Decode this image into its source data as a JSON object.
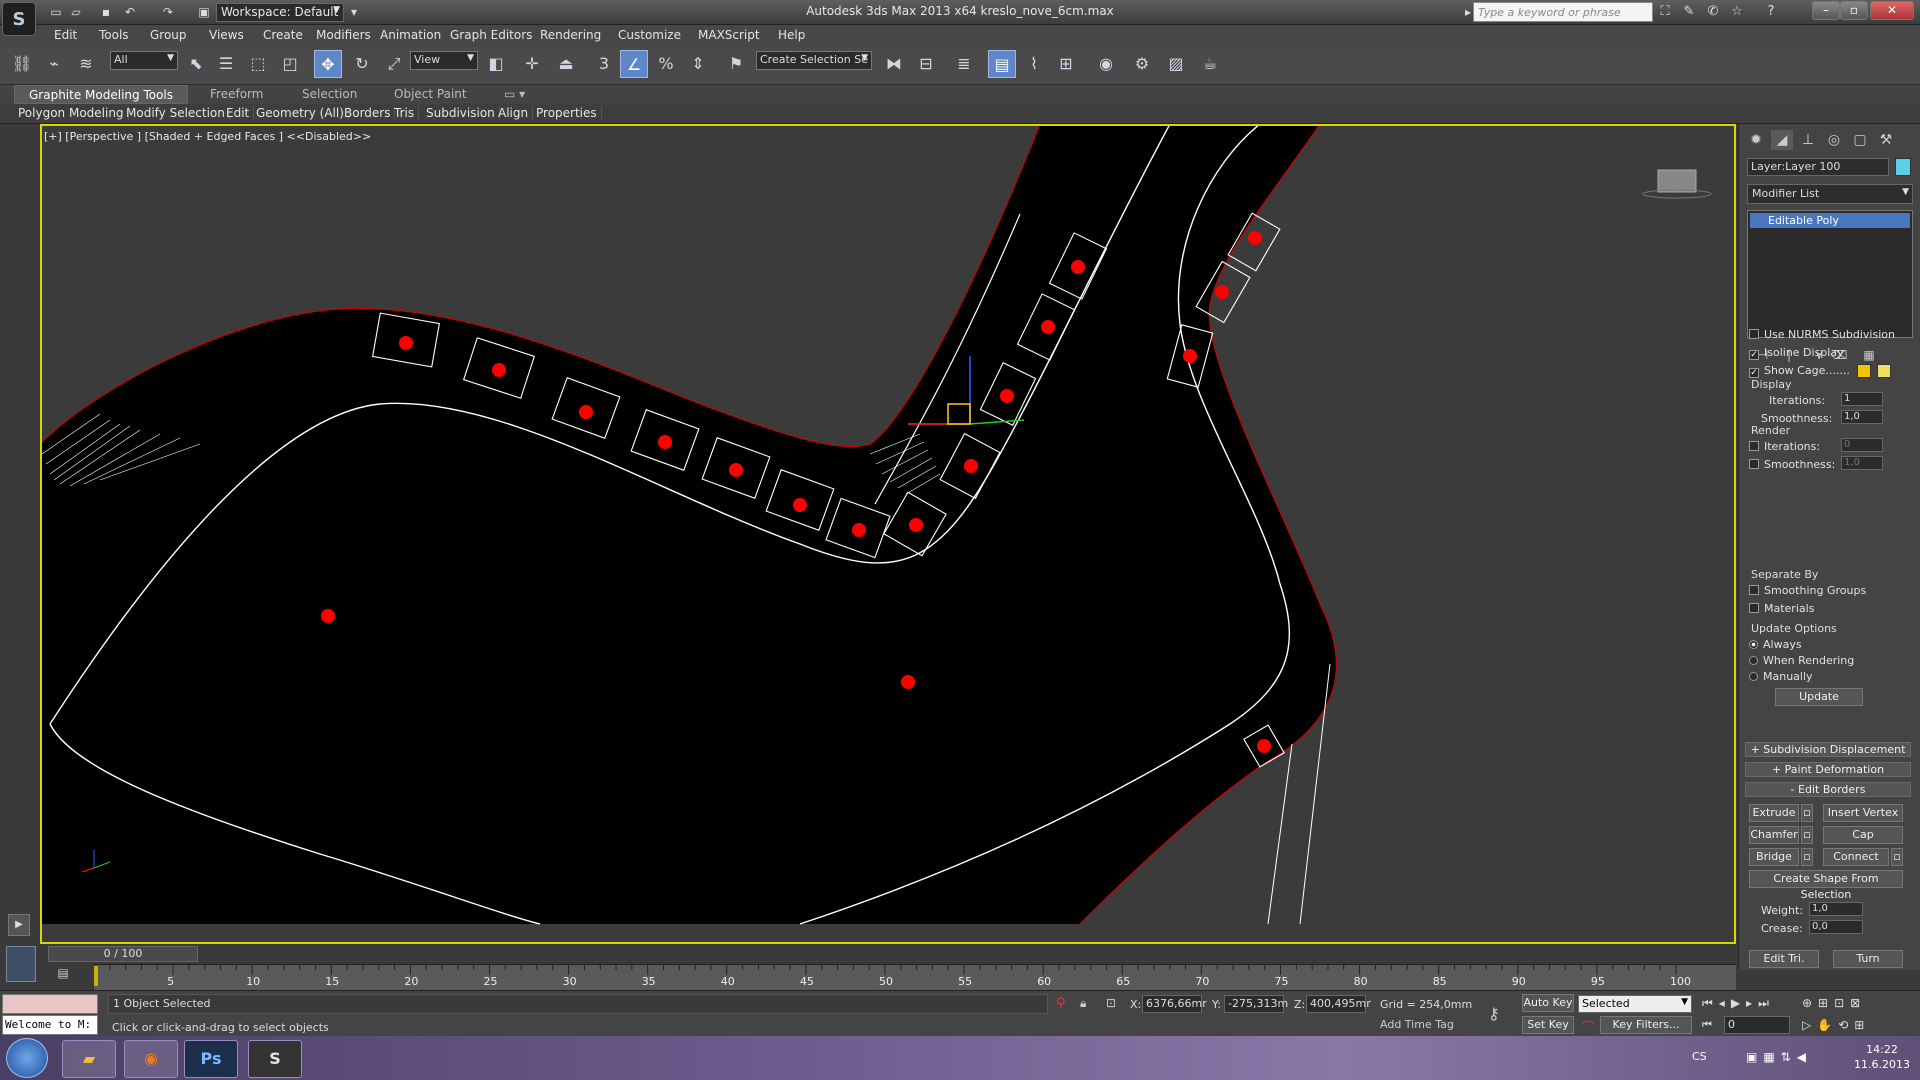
{
  "title_bar": {
    "app_logo": "S",
    "workspace_label": "Workspace: Default",
    "window_title": "Autodesk 3ds Max  2013 x64      kreslo_nove_6cm.max",
    "search_placeholder": "Type a keyword or phrase",
    "min": "–",
    "max": "▫",
    "close": "✕"
  },
  "menu": [
    "Edit",
    "Tools",
    "Group",
    "Views",
    "Create",
    "Modifiers",
    "Animation",
    "Graph Editors",
    "Rendering",
    "Customize",
    "MAXScript",
    "Help"
  ],
  "toolbar": {
    "selection_filter": "All",
    "ref_coord": "View",
    "named_selection": "Create Selection Se",
    "snap_label": "3"
  },
  "ribbon": {
    "tabs": [
      "Graphite Modeling Tools",
      "Freeform",
      "Selection",
      "Object Paint"
    ],
    "panels": [
      "Polygon Modeling",
      "Modify Selection",
      "Edit",
      "Geometry (All)",
      "Borders",
      "Tris",
      "Subdivision",
      "Align",
      "Properties"
    ]
  },
  "viewport": {
    "label": "[+] [Perspective ] [Shaded + Edged Faces ]  <<Disabled>>",
    "colors": {
      "background": "#3b3b3b",
      "mesh": "#000000",
      "dots": "#ff0000",
      "edges": "#ffffff",
      "border": "#cc0000"
    }
  },
  "command_panel": {
    "layer": "Layer:Layer 100",
    "modifier_list": "Modifier List",
    "stack_item": "Editable Poly",
    "use_nurms": "Use NURMS Subdivision",
    "isoline": "Isoline Display",
    "show_cage": "Show Cage.......",
    "display_label": "Display",
    "iterations_label": "Iterations:",
    "iterations_value": "1",
    "smoothness_label": "Smoothness:",
    "smoothness_value": "1,0",
    "render_label": "Render",
    "render_iterations_value": "0",
    "render_smoothness_value": "1,0",
    "separate_by": "Separate By",
    "smoothing_groups": "Smoothing Groups",
    "materials": "Materials",
    "update_options": "Update Options",
    "always": "Always",
    "when_rendering": "When Rendering",
    "manually": "Manually",
    "update": "Update",
    "subdiv_displacement": "Subdivision Displacement",
    "paint_deformation": "Paint Deformation",
    "edit_borders": "Edit Borders",
    "extrude": "Extrude",
    "insert_vertex": "Insert Vertex",
    "chamfer": "Chamfer",
    "cap": "Cap",
    "bridge": "Bridge",
    "connect": "Connect",
    "create_shape": "Create Shape From Selection",
    "weight_label": "Weight:",
    "weight_value": "1,0",
    "crease_label": "Crease:",
    "crease_value": "0,0",
    "edit_tri": "Edit Tri.",
    "turn": "Turn"
  },
  "timeline": {
    "slider": "0 / 100",
    "ticks": [
      "5",
      "10",
      "15",
      "20",
      "25",
      "30",
      "35",
      "40",
      "45",
      "50",
      "55",
      "60",
      "65",
      "70",
      "75",
      "80",
      "85",
      "90",
      "95",
      "100"
    ]
  },
  "status": {
    "welcome": "Welcome to M:",
    "selected": "1 Object Selected",
    "prompt": "Click or click-and-drag to select objects",
    "x_label": "X:",
    "x_value": "6376,66mr",
    "y_label": "Y:",
    "y_value": "-275,313m",
    "z_label": "Z:",
    "z_value": "400,495mr",
    "grid": "Grid = 254,0mm",
    "auto_key": "Auto Key",
    "set_key": "Set Key",
    "selected_dropdown": "Selected",
    "key_filters": "Key Filters...",
    "add_time_tag": "Add Time Tag",
    "frame_value": "0"
  },
  "taskbar": {
    "lang": "CS",
    "time": "14:22",
    "date": "11.6.2013",
    "ps_label": "Ps"
  }
}
